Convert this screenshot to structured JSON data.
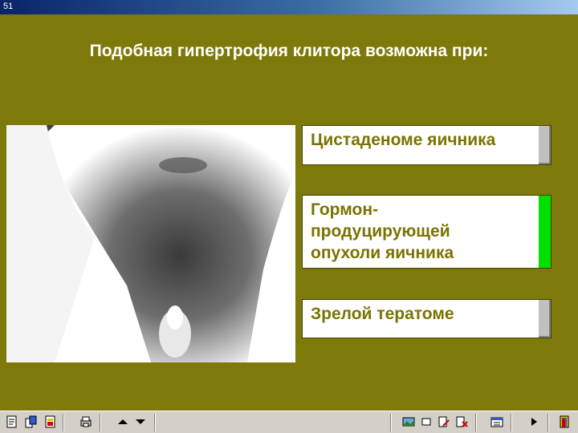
{
  "window": {
    "title": "51"
  },
  "question": "Подобная гипертрофия клитора возможна при:",
  "answers": [
    {
      "line1": "Цистаденоме яичника",
      "line2": "",
      "line3": "",
      "state": "neutral"
    },
    {
      "line1": "Гормон-",
      "line2": "продуцирующей",
      "line3": "опухоли яичника",
      "state": "correct"
    },
    {
      "line1": "Зрелой тератоме",
      "line2": "",
      "line3": "",
      "state": "neutral"
    }
  ],
  "colors": {
    "background": "#7d7a0b",
    "answer_text": "#7a7300",
    "correct": "#00e000",
    "neutral": "#c0c0c0"
  },
  "toolbar": {
    "left_icons": [
      "notes-icon",
      "copy-icon",
      "export-icon",
      "print-icon"
    ],
    "nav_icons": [
      "arrow-up-icon",
      "arrow-down-icon"
    ],
    "right_icons": [
      "image-icon",
      "frame-icon",
      "edit-icon",
      "delete-icon",
      "calendar-icon",
      "play-icon",
      "exit-icon"
    ]
  }
}
